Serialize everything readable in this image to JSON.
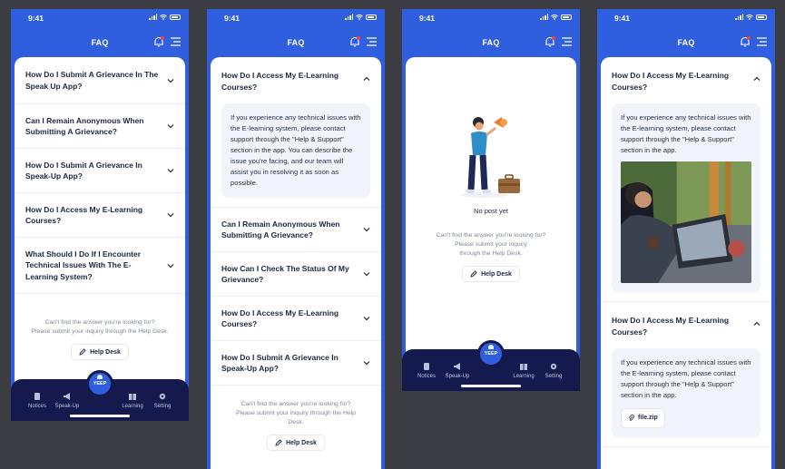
{
  "status_time": "9:41",
  "header_title": "FAQ",
  "help": {
    "line1": "Can't find the answer you're looking for?",
    "line2": "Please submit your inquiry through the Help Desk.",
    "p2_line1": "Can't find the answer you're looking for?",
    "p2_line2": "Please submit your inquiry through the Help",
    "p2_line3": "Desk.",
    "p3_line1": "Can't find the answer you're looking for?",
    "p3_line2": "Please submit your inquiry",
    "p3_line3": "through the Help Desk.",
    "button": "Help Desk"
  },
  "tabs": {
    "notices": "Notices",
    "speakup": "Speak-Up",
    "center": "YEEP",
    "learning": "Learning",
    "setting": "Setting"
  },
  "screen1": {
    "faqs": [
      "How Do I Submit A Grievance In The Speak Up App?",
      "Can I Remain Anonymous When Submitting A Grievance?",
      "How Do I Submit A Grievance In Speak-Up App?",
      "How Do I Access My E-Learning Courses?",
      "What Should I Do If I Encounter Technical Issues With The E-Learning System?"
    ]
  },
  "screen2": {
    "open_question": "How Do I Access My E-Learning Courses?",
    "open_answer": "If you experience any technical issues with the E-learning system, please contact support through the \"Help & Support\" section in the app. You can describe the issue you're facing, and our team will assist you in resolving it as soon as possible.",
    "faqs": [
      "Can I Remain Anonymous When Submitting A Grievance?",
      "How Can I Check The Status Of My Grievance?",
      "How Do I Access My E-Learning Courses?",
      "How Do I Submit A Grievance In Speak-Up App?"
    ]
  },
  "screen3": {
    "empty_text": "No post yet"
  },
  "screen4": {
    "q1": "How Do I Access My E-Learning Courses?",
    "a1": "If you experience any technical issues with the E-learning system, please contact support through the \"Help & Support\" section in the app.",
    "q2": "How Do I Access My E-Learning Courses?",
    "a2": "If you experience any technical issues with the E-learning system, please contact support through the \"Help & Support\" section in the app.",
    "file_name": "file.zip"
  },
  "colors": {
    "brand_blue": "#2f5fde",
    "tabbar_navy": "#141a4e",
    "background": "#3c3d42"
  }
}
